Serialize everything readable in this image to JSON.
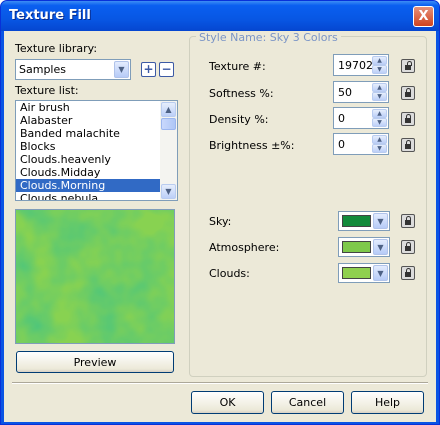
{
  "window": {
    "title": "Texture Fill",
    "close_glyph": "X"
  },
  "left": {
    "library_label": "Texture library:",
    "library_value": "Samples",
    "add_glyph": "+",
    "remove_glyph": "−",
    "list_label": "Texture list:",
    "list_items": [
      "Air brush",
      "Alabaster",
      "Banded malachite",
      "Blocks",
      "Clouds.heavenly",
      "Clouds.Midday",
      "Clouds.Morning",
      "Clouds.nebula"
    ],
    "selected_index": 6,
    "preview_button": "Preview"
  },
  "style": {
    "group_title": "Style Name: Sky 3 Colors",
    "texture_label": "Texture #:",
    "texture_value": "19702",
    "softness_label": "Softness %:",
    "softness_value": "50",
    "density_label": "Density %:",
    "density_value": "0",
    "brightness_label": "Brightness ±%:",
    "brightness_value": "0",
    "sky_label": "Sky:",
    "sky_color": "#138a3a",
    "atmosphere_label": "Atmosphere:",
    "atmosphere_color": "#7ec94a",
    "clouds_label": "Clouds:",
    "clouds_color": "#8fd04e"
  },
  "footer": {
    "ok": "OK",
    "cancel": "Cancel",
    "help": "Help"
  }
}
